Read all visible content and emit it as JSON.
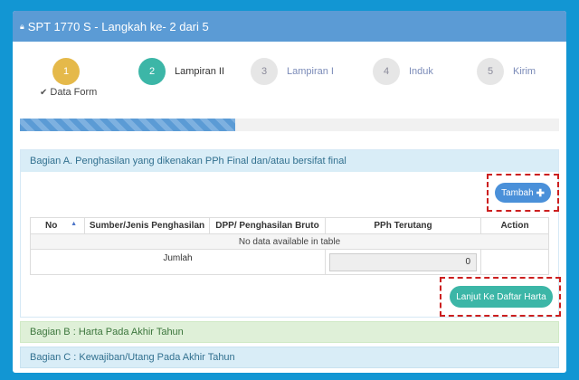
{
  "header": {
    "title": "SPT 1770 S - Langkah ke- 2 dari 5"
  },
  "stepper": {
    "steps": [
      {
        "number": "1",
        "label": "",
        "sub": "Data Form",
        "color": "#e5b94a"
      },
      {
        "number": "2",
        "label": "Lampiran II",
        "color": "#3cb6a7"
      },
      {
        "number": "3",
        "label": "Lampiran I"
      },
      {
        "number": "4",
        "label": "Induk"
      },
      {
        "number": "5",
        "label": "Kirim"
      }
    ]
  },
  "progress": {
    "fraction": 0.4
  },
  "section_a": {
    "title": "Bagian A. Penghasilan yang dikenakan PPh Final dan/atau bersifat final",
    "add_label": "Tambah",
    "table": {
      "columns": [
        "No",
        "Sumber/Jenis Penghasilan",
        "DPP/ Penghasilan Bruto",
        "PPh Terutang",
        "Action"
      ],
      "empty_message": "No data available in table",
      "total_label": "Jumlah",
      "total_value": "0"
    },
    "next_label": "Lanjut Ke Daftar Harta"
  },
  "section_b": {
    "title": "Bagian B : Harta Pada Akhir Tahun"
  },
  "section_c": {
    "title": "Bagian C : Kewajiban/Utang Pada Akhir Tahun"
  }
}
